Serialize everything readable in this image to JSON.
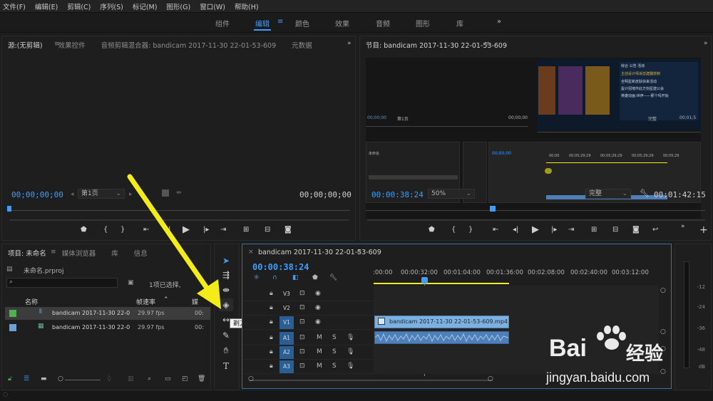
{
  "menu": [
    "文件(F)",
    "编辑(E)",
    "剪辑(C)",
    "序列(S)",
    "标记(M)",
    "图形(G)",
    "窗口(W)",
    "帮助(H)"
  ],
  "workspaces": [
    "组件",
    "编辑",
    "颜色",
    "效果",
    "音频",
    "图形",
    "库"
  ],
  "workspace_more": "»",
  "source_panel": {
    "tabs": [
      "源:(无剪辑)",
      "效果控件",
      "音频剪辑混合器: bandicam 2017-11-30 22-01-53-609",
      "元数据"
    ],
    "timecode_left": "00;00;00;00",
    "page_label": "第1页",
    "timecode_right": "00;00;00;00"
  },
  "program_panel": {
    "title": "节目: bandicam 2017-11-30 22-01-53-609",
    "timecode_left": "00:00:38:24",
    "zoom": "50%",
    "quality": "完整",
    "timecode_right": "00:01:42:15",
    "nested": {
      "tl_start": "00;00;00",
      "tl_end": "00;00;00",
      "page": "第1页",
      "quality": "完整",
      "duration": "00;01;5",
      "nested_tc": "00;00;00",
      "project_label": "未命名",
      "ruler_marks": [
        "00;00",
        "00;05;29;29",
        "00;05;29;29",
        "00;05;29;29",
        "00;05;29"
      ],
      "screen_lines": [
        "综合",
        "公告",
        "活动",
        "主创设计师诉剪建器技制",
        "全明星新皮肤快来活动",
        "設计招墙作此方刻星建公会",
        "英雄动画:世伊——那个吗开始"
      ]
    }
  },
  "project_panel": {
    "tabs": [
      "项目: 未命名",
      "媒体浏览器",
      "库",
      "信息"
    ],
    "file": "未命名.prproj",
    "search_placeholder": "",
    "selection_info": "1项已选择,",
    "columns": [
      "名称",
      "帧速率",
      "媒"
    ],
    "rows": [
      {
        "name": "bandicam 2017-11-30 22-01-5",
        "fps": "29.97 fps",
        "media": "00:",
        "color": "#4fb24f"
      },
      {
        "name": "bandicam 2017-11-30 22-01-5",
        "fps": "29.97 fps",
        "media": "00:",
        "color": "#6f9fd8"
      }
    ]
  },
  "tools": {
    "tooltip": "剃刀工具 (C)"
  },
  "timeline": {
    "title": "bandicam 2017-11-30 22-01-53-609",
    "timecode": "00:00:38:24",
    "ruler": [
      ":00:00",
      "00:00:32:00",
      "00:01:04:00",
      "00:01:36:00",
      "00:02:08:00",
      "00:02:40:00",
      "00:03:12:00"
    ],
    "video_tracks": [
      "V3",
      "V2",
      "V1"
    ],
    "audio_tracks": [
      "A1",
      "A2",
      "A3"
    ],
    "track_buttons": {
      "mute": "M",
      "solo": "S"
    },
    "video_clip": "bandicam 2017-11-30 22-01-53-609.mp4 [V]"
  },
  "meter": {
    "ticks": [
      "-12",
      "-24",
      "-36",
      "-48",
      "dB"
    ]
  },
  "watermark": {
    "brand": "Bai",
    "brand2": "经验",
    "url": "jingyan.baidu.com"
  },
  "colors": {
    "accent": "#3f9dfa",
    "arrow": "#f4ec1a",
    "video_clip": "#7db1e0",
    "audio_clip": "#4e7fb9"
  }
}
